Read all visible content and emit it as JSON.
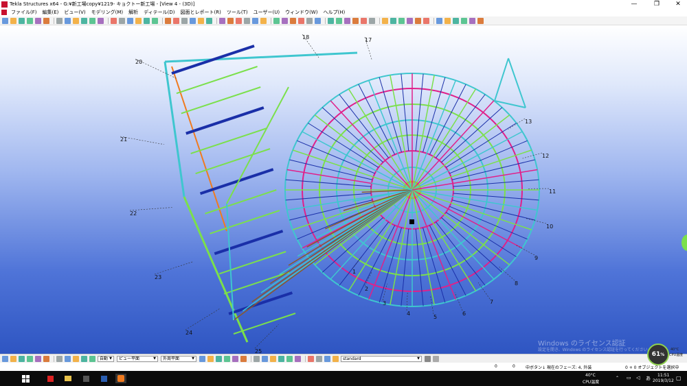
{
  "window": {
    "title": "Tekla Structures x64 - G:¥新工場copy¥1219- キョクトー新工場 - [View 4 - (3D)]",
    "controls": [
      "—",
      "❐",
      "✕"
    ]
  },
  "menu": [
    "ファイル(F)",
    "編集(E)",
    "ビュー(V)",
    "モデリング(M)",
    "解析",
    "ディテール(D)",
    "図面とレポート(R)",
    "ツール(T)",
    "ユーザー(U)",
    "ウィンドウ(W)",
    "ヘルプ(H)"
  ],
  "grid_labels": [
    "1",
    "2",
    "3",
    "4",
    "5",
    "6",
    "7",
    "8",
    "9",
    "10",
    "11",
    "12",
    "13",
    "17",
    "18",
    "20",
    "21",
    "22",
    "23",
    "24",
    "25"
  ],
  "bottom_toolbar": {
    "snap_select": "自動",
    "plane_select": "ビュー平面",
    "depth_select": "外周平面",
    "filter_select": "standard"
  },
  "status": {
    "value_x": "0",
    "value_y": "0",
    "message": "中ボタン↓ 現在のフェーズ: 4, 外装",
    "selection": "0 + 0 オブジェクトを選択中"
  },
  "watermark": {
    "line1": "Windows のライセンス認証",
    "line2": "設定を開き、Windows のライセンス認証を行ってください。"
  },
  "gauge": {
    "percent": "61",
    "unit": "%",
    "temp": "40°C",
    "temp_label": "CPU温度"
  },
  "taskbar": {
    "cpu_temp": "40°C",
    "cpu_label": "CPU温度",
    "ime": "あ",
    "time": "11:51",
    "date": "2019/3/12"
  },
  "colors": {
    "cyan": "#3fc6cf",
    "green": "#7be04b",
    "magenta": "#e0208a",
    "navy": "#1a2fa8",
    "orange": "#f07a1f",
    "brown": "#8a5a2b"
  }
}
